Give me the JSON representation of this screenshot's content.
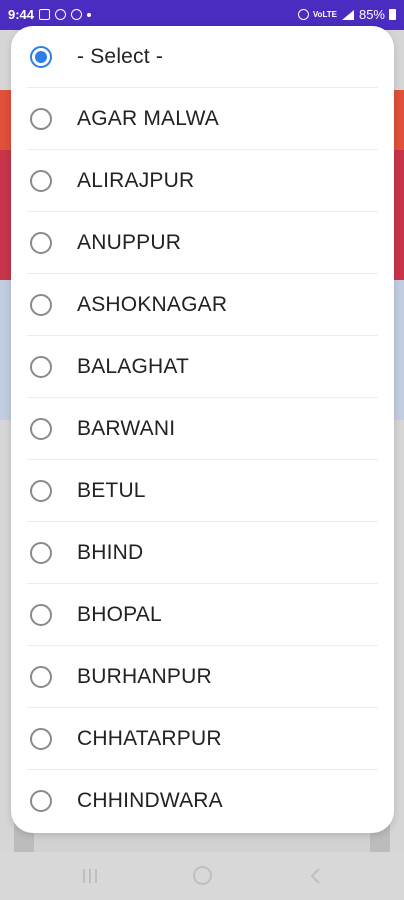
{
  "status_bar": {
    "time": "9:44",
    "network_label": "VoLTE",
    "battery": "85%",
    "icons": [
      "image-icon",
      "messenger-icon",
      "chrome-icon",
      "dot-icon",
      "hotspot-icon",
      "signal-icon",
      "battery-icon"
    ]
  },
  "dialog": {
    "options": [
      {
        "label": "- Select -",
        "selected": true
      },
      {
        "label": "AGAR MALWA",
        "selected": false
      },
      {
        "label": "ALIRAJPUR",
        "selected": false
      },
      {
        "label": "ANUPPUR",
        "selected": false
      },
      {
        "label": "ASHOKNAGAR",
        "selected": false
      },
      {
        "label": "BALAGHAT",
        "selected": false
      },
      {
        "label": "BARWANI",
        "selected": false
      },
      {
        "label": "BETUL",
        "selected": false
      },
      {
        "label": "BHIND",
        "selected": false
      },
      {
        "label": "BHOPAL",
        "selected": false
      },
      {
        "label": "BURHANPUR",
        "selected": false
      },
      {
        "label": "CHHATARPUR",
        "selected": false
      },
      {
        "label": "CHHINDWARA",
        "selected": false
      }
    ]
  },
  "colors": {
    "accent": "#2b7fe6",
    "status_bar": "#4a2cc0"
  }
}
